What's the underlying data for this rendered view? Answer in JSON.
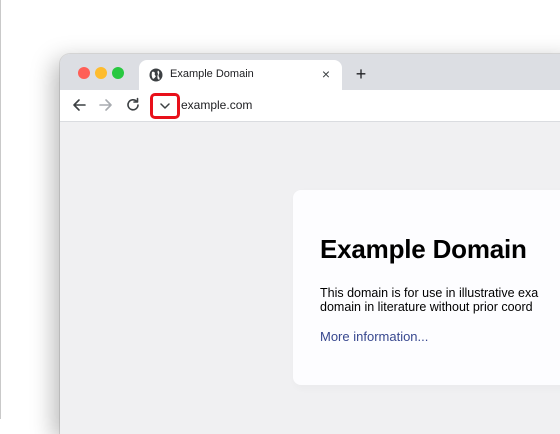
{
  "browser": {
    "tab": {
      "title": "Example Domain",
      "close_symbol": "×",
      "favicon": "globe-icon"
    },
    "new_tab_symbol": "+",
    "toolbar": {
      "back_icon": "arrow-left-icon",
      "forward_icon": "arrow-right-icon",
      "reload_icon": "reload-icon",
      "site_info_icon": "chevron-down-icon",
      "url": "example.com",
      "highlight_color": "#e8101a"
    }
  },
  "page": {
    "heading": "Example Domain",
    "paragraph_line1": "This domain is for use in illustrative exa",
    "paragraph_line2": "domain in literature without prior coord",
    "link_text": "More information...",
    "link_color": "#38488f"
  }
}
